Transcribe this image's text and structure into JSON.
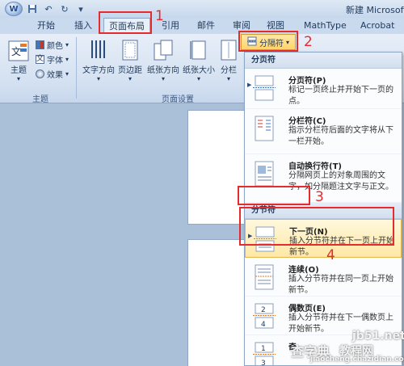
{
  "titlebar": {
    "logo_text": "W",
    "save_icon": "save-icon",
    "undo_icon": "undo-icon",
    "redo_icon": "redo-icon",
    "doc_title": "新建 Microsoft"
  },
  "tabs": [
    {
      "label": "开始"
    },
    {
      "label": "插入"
    },
    {
      "label": "页面布局",
      "active": true
    },
    {
      "label": "引用"
    },
    {
      "label": "邮件"
    },
    {
      "label": "审阅"
    },
    {
      "label": "视图"
    },
    {
      "label": "MathType"
    },
    {
      "label": "Acrobat"
    }
  ],
  "ribbon": {
    "theme_group": {
      "label": "主题",
      "theme_button": "主题",
      "colors": "颜色",
      "fonts": "字体",
      "effects": "效果"
    },
    "page_setup_group": {
      "label": "页面设置",
      "buttons": [
        "文字方向",
        "页边距",
        "纸张方向",
        "纸张大小",
        "分栏"
      ]
    },
    "breaks_button": "分隔符"
  },
  "menu": {
    "page_breaks_header": "分页符",
    "section_breaks_header": "分节符",
    "items": [
      {
        "title": "分页符(P)",
        "desc": "标记一页终止并开始下一页的点。"
      },
      {
        "title": "分栏符(C)",
        "desc": "指示分栏符后面的文字将从下一栏开始。"
      },
      {
        "title": "自动换行符(T)",
        "desc": "分隔网页上的对象周围的文字，如分隔题注文字与正文。"
      },
      {
        "title": "下一页(N)",
        "desc": "插入分节符并在下一页上开始新节。"
      },
      {
        "title": "连续(O)",
        "desc": "插入分节符并在同一页上开始新节。"
      },
      {
        "title": "偶数页(E)",
        "desc": "插入分节符并在下一偶数页上开始新节。"
      },
      {
        "title": "奇",
        "desc": ""
      }
    ]
  },
  "annotations": [
    "1",
    "2",
    "3",
    "4"
  ],
  "watermark": {
    "site": "jb51.net",
    "text1": "查字典",
    "text2": "教程网",
    "url": "jiaocheng.chazidian.com"
  },
  "colors": {
    "annotation_red": "#e52b2b",
    "highlight": "#ffe8a6",
    "ribbon": "#d4e1f1"
  }
}
